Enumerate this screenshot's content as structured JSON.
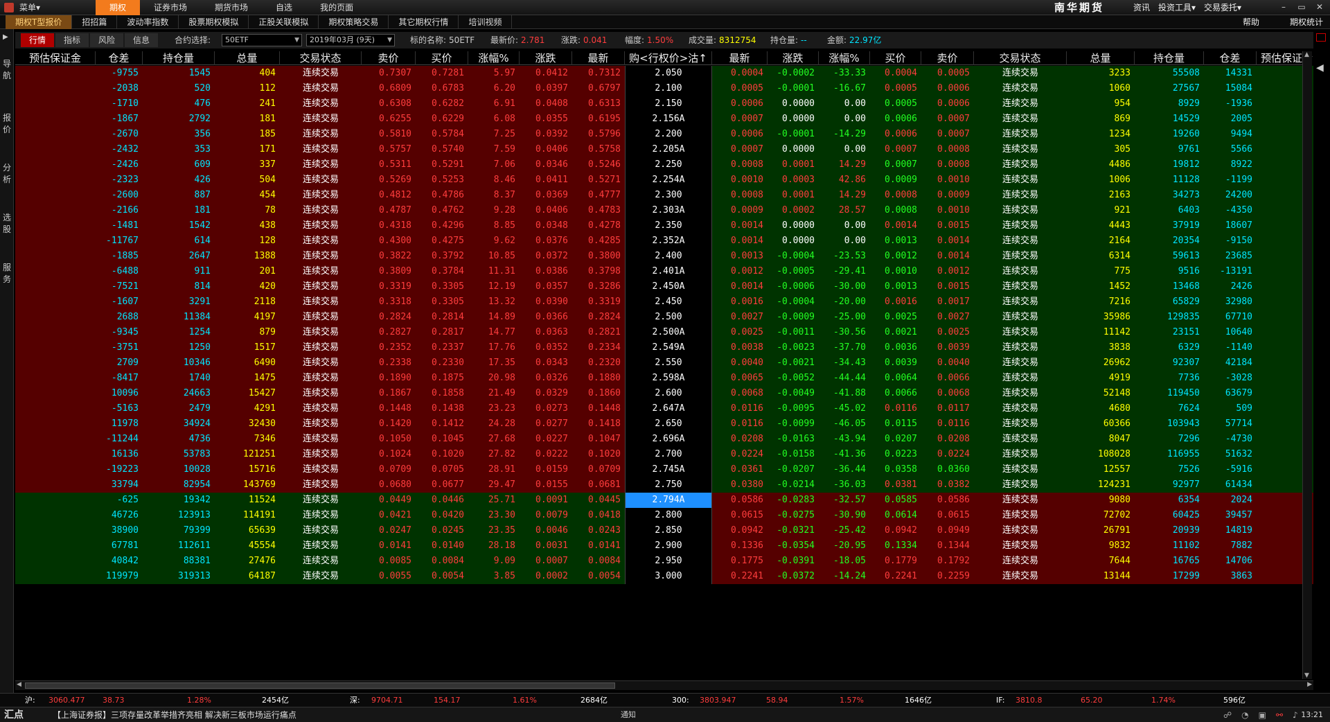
{
  "topbar": {
    "menu_label": "菜单▾",
    "tabs": [
      "期权",
      "证券市场",
      "期货市场",
      "自选",
      "我的页面"
    ],
    "brand": "南华期货",
    "right": [
      "资讯",
      "投资工具▾",
      "交易委托▾"
    ],
    "window_controls": [
      "–",
      "▭",
      "✕"
    ]
  },
  "subbar": {
    "tabs": [
      "期权T型报价",
      "招招篇",
      "波动率指数",
      "股票期权模拟",
      "正股关联模拟",
      "期权策略交易",
      "其它期权行情",
      "培训视频"
    ],
    "right": [
      "帮助",
      "期权统计"
    ]
  },
  "leftnav": [
    "导航",
    "报价",
    "分析",
    "选股",
    "服务"
  ],
  "toolbar": {
    "tabs": [
      "行情",
      "指标",
      "风险",
      "信息"
    ],
    "contract_label": "合约选择:",
    "contract_value": "50ETF",
    "month_value": "2019年03月 (9天)",
    "underlying_label": "标的名称:",
    "underlying_value": "50ETF",
    "last_label": "最新价:",
    "last_value": "2.781",
    "chg_label": "涨跌:",
    "chg_value": "0.041",
    "amp_label": "幅度:",
    "amp_value": "1.50%",
    "vol_label": "成交量:",
    "vol_value": "8312754",
    "oi_label": "持仓量:",
    "oi_value": "--",
    "amt_label": "金额:",
    "amt_value": "22.97亿"
  },
  "headers": [
    "预估保证金",
    "仓差",
    "持仓量",
    "总量",
    "交易状态",
    "卖价",
    "买价",
    "涨幅%",
    "涨跌",
    "最新",
    "购<行权价>沽↑",
    "最新",
    "涨跌",
    "涨幅%",
    "买价",
    "卖价",
    "交易状态",
    "总量",
    "持仓量",
    "仓差",
    "预估保证金"
  ],
  "status_text": "连续交易",
  "highlight_strike": "2.794A",
  "rows": [
    {
      "cd": "-9755",
      "coi": "1545",
      "cv": "404",
      "cs": "0.7307",
      "cb": "0.7281",
      "cp": "5.97",
      "cc": "0.0412",
      "cl": "0.7312",
      "k": "2.050",
      "pl": "0.0004",
      "pc": "-0.0002",
      "pp": "-33.33",
      "pb": "0.0004",
      "ps": "0.0005",
      "pv": "3233",
      "poi": "55508",
      "pd": "14331"
    },
    {
      "cd": "-2038",
      "coi": "520",
      "cv": "112",
      "cs": "0.6809",
      "cb": "0.6783",
      "cp": "6.20",
      "cc": "0.0397",
      "cl": "0.6797",
      "k": "2.100",
      "pl": "0.0005",
      "pc": "-0.0001",
      "pp": "-16.67",
      "pb": "0.0005",
      "ps": "0.0006",
      "pv": "1060",
      "poi": "27567",
      "pd": "15084"
    },
    {
      "cd": "-1710",
      "coi": "476",
      "cv": "241",
      "cs": "0.6308",
      "cb": "0.6282",
      "cp": "6.91",
      "cc": "0.0408",
      "cl": "0.6313",
      "k": "2.150",
      "pl": "0.0006",
      "pc": "0.0000",
      "pp": "0.00",
      "pb": "0.0005",
      "ps": "0.0006",
      "pv": "954",
      "poi": "8929",
      "pd": "-1936"
    },
    {
      "cd": "-1867",
      "coi": "2792",
      "cv": "181",
      "cs": "0.6255",
      "cb": "0.6229",
      "cp": "6.08",
      "cc": "0.0355",
      "cl": "0.6195",
      "k": "2.156A",
      "pl": "0.0007",
      "pc": "0.0000",
      "pp": "0.00",
      "pb": "0.0006",
      "ps": "0.0007",
      "pv": "869",
      "poi": "14529",
      "pd": "2005"
    },
    {
      "cd": "-2670",
      "coi": "356",
      "cv": "185",
      "cs": "0.5810",
      "cb": "0.5784",
      "cp": "7.25",
      "cc": "0.0392",
      "cl": "0.5796",
      "k": "2.200",
      "pl": "0.0006",
      "pc": "-0.0001",
      "pp": "-14.29",
      "pb": "0.0006",
      "ps": "0.0007",
      "pv": "1234",
      "poi": "19260",
      "pd": "9494"
    },
    {
      "cd": "-2432",
      "coi": "353",
      "cv": "171",
      "cs": "0.5757",
      "cb": "0.5740",
      "cp": "7.59",
      "cc": "0.0406",
      "cl": "0.5758",
      "k": "2.205A",
      "pl": "0.0007",
      "pc": "0.0000",
      "pp": "0.00",
      "pb": "0.0007",
      "ps": "0.0008",
      "pv": "305",
      "poi": "9761",
      "pd": "5566"
    },
    {
      "cd": "-2426",
      "coi": "609",
      "cv": "337",
      "cs": "0.5311",
      "cb": "0.5291",
      "cp": "7.06",
      "cc": "0.0346",
      "cl": "0.5246",
      "k": "2.250",
      "pl": "0.0008",
      "pc": "0.0001",
      "pp": "14.29",
      "pb": "0.0007",
      "ps": "0.0008",
      "pv": "4486",
      "poi": "19812",
      "pd": "8922"
    },
    {
      "cd": "-2323",
      "coi": "426",
      "cv": "504",
      "cs": "0.5269",
      "cb": "0.5253",
      "cp": "8.46",
      "cc": "0.0411",
      "cl": "0.5271",
      "k": "2.254A",
      "pl": "0.0010",
      "pc": "0.0003",
      "pp": "42.86",
      "pb": "0.0009",
      "ps": "0.0010",
      "pv": "1006",
      "poi": "11128",
      "pd": "-1199"
    },
    {
      "cd": "-2600",
      "coi": "887",
      "cv": "454",
      "cs": "0.4812",
      "cb": "0.4786",
      "cp": "8.37",
      "cc": "0.0369",
      "cl": "0.4777",
      "k": "2.300",
      "pl": "0.0008",
      "pc": "0.0001",
      "pp": "14.29",
      "pb": "0.0008",
      "ps": "0.0009",
      "pv": "2163",
      "poi": "34273",
      "pd": "24200"
    },
    {
      "cd": "-2166",
      "coi": "181",
      "cv": "78",
      "cs": "0.4787",
      "cb": "0.4762",
      "cp": "9.28",
      "cc": "0.0406",
      "cl": "0.4783",
      "k": "2.303A",
      "pl": "0.0009",
      "pc": "0.0002",
      "pp": "28.57",
      "pb": "0.0008",
      "ps": "0.0010",
      "pv": "921",
      "poi": "6403",
      "pd": "-4350"
    },
    {
      "cd": "-1481",
      "coi": "1542",
      "cv": "438",
      "cs": "0.4318",
      "cb": "0.4296",
      "cp": "8.85",
      "cc": "0.0348",
      "cl": "0.4278",
      "k": "2.350",
      "pl": "0.0014",
      "pc": "0.0000",
      "pp": "0.00",
      "pb": "0.0014",
      "ps": "0.0015",
      "pv": "4443",
      "poi": "37919",
      "pd": "18607"
    },
    {
      "cd": "-11767",
      "coi": "614",
      "cv": "128",
      "cs": "0.4300",
      "cb": "0.4275",
      "cp": "9.62",
      "cc": "0.0376",
      "cl": "0.4285",
      "k": "2.352A",
      "pl": "0.0014",
      "pc": "0.0000",
      "pp": "0.00",
      "pb": "0.0013",
      "ps": "0.0014",
      "pv": "2164",
      "poi": "20354",
      "pd": "-9150"
    },
    {
      "cd": "-1885",
      "coi": "2647",
      "cv": "1388",
      "cs": "0.3822",
      "cb": "0.3792",
      "cp": "10.85",
      "cc": "0.0372",
      "cl": "0.3800",
      "k": "2.400",
      "pl": "0.0013",
      "pc": "-0.0004",
      "pp": "-23.53",
      "pb": "0.0012",
      "ps": "0.0014",
      "pv": "6314",
      "poi": "59613",
      "pd": "23685"
    },
    {
      "cd": "-6488",
      "coi": "911",
      "cv": "201",
      "cs": "0.3809",
      "cb": "0.3784",
      "cp": "11.31",
      "cc": "0.0386",
      "cl": "0.3798",
      "k": "2.401A",
      "pl": "0.0012",
      "pc": "-0.0005",
      "pp": "-29.41",
      "pb": "0.0010",
      "ps": "0.0012",
      "pv": "775",
      "poi": "9516",
      "pd": "-13191"
    },
    {
      "cd": "-7521",
      "coi": "814",
      "cv": "420",
      "cs": "0.3319",
      "cb": "0.3305",
      "cp": "12.19",
      "cc": "0.0357",
      "cl": "0.3286",
      "k": "2.450A",
      "pl": "0.0014",
      "pc": "-0.0006",
      "pp": "-30.00",
      "pb": "0.0013",
      "ps": "0.0015",
      "pv": "1452",
      "poi": "13468",
      "pd": "2426"
    },
    {
      "cd": "-1607",
      "coi": "3291",
      "cv": "2118",
      "cs": "0.3318",
      "cb": "0.3305",
      "cp": "13.32",
      "cc": "0.0390",
      "cl": "0.3319",
      "k": "2.450",
      "pl": "0.0016",
      "pc": "-0.0004",
      "pp": "-20.00",
      "pb": "0.0016",
      "ps": "0.0017",
      "pv": "7216",
      "poi": "65829",
      "pd": "32980"
    },
    {
      "cd": "2688",
      "coi": "11384",
      "cv": "4197",
      "cs": "0.2824",
      "cb": "0.2814",
      "cp": "14.89",
      "cc": "0.0366",
      "cl": "0.2824",
      "k": "2.500",
      "pl": "0.0027",
      "pc": "-0.0009",
      "pp": "-25.00",
      "pb": "0.0025",
      "ps": "0.0027",
      "pv": "35986",
      "poi": "129835",
      "pd": "67710"
    },
    {
      "cd": "-9345",
      "coi": "1254",
      "cv": "879",
      "cs": "0.2827",
      "cb": "0.2817",
      "cp": "14.77",
      "cc": "0.0363",
      "cl": "0.2821",
      "k": "2.500A",
      "pl": "0.0025",
      "pc": "-0.0011",
      "pp": "-30.56",
      "pb": "0.0021",
      "ps": "0.0025",
      "pv": "11142",
      "poi": "23151",
      "pd": "10640"
    },
    {
      "cd": "-3751",
      "coi": "1250",
      "cv": "1517",
      "cs": "0.2352",
      "cb": "0.2337",
      "cp": "17.76",
      "cc": "0.0352",
      "cl": "0.2334",
      "k": "2.549A",
      "pl": "0.0038",
      "pc": "-0.0023",
      "pp": "-37.70",
      "pb": "0.0036",
      "ps": "0.0039",
      "pv": "3838",
      "poi": "6329",
      "pd": "-1140"
    },
    {
      "cd": "2709",
      "coi": "10346",
      "cv": "6490",
      "cs": "0.2338",
      "cb": "0.2330",
      "cp": "17.35",
      "cc": "0.0343",
      "cl": "0.2320",
      "k": "2.550",
      "pl": "0.0040",
      "pc": "-0.0021",
      "pp": "-34.43",
      "pb": "0.0039",
      "ps": "0.0040",
      "pv": "26962",
      "poi": "92307",
      "pd": "42184"
    },
    {
      "cd": "-8417",
      "coi": "1740",
      "cv": "1475",
      "cs": "0.1890",
      "cb": "0.1875",
      "cp": "20.98",
      "cc": "0.0326",
      "cl": "0.1880",
      "k": "2.598A",
      "pl": "0.0065",
      "pc": "-0.0052",
      "pp": "-44.44",
      "pb": "0.0064",
      "ps": "0.0066",
      "pv": "4919",
      "poi": "7736",
      "pd": "-3028"
    },
    {
      "cd": "10096",
      "coi": "24663",
      "cv": "15427",
      "cs": "0.1867",
      "cb": "0.1858",
      "cp": "21.49",
      "cc": "0.0329",
      "cl": "0.1860",
      "k": "2.600",
      "pl": "0.0068",
      "pc": "-0.0049",
      "pp": "-41.88",
      "pb": "0.0066",
      "ps": "0.0068",
      "pv": "52148",
      "poi": "119450",
      "pd": "63679"
    },
    {
      "cd": "-5163",
      "coi": "2479",
      "cv": "4291",
      "cs": "0.1448",
      "cb": "0.1438",
      "cp": "23.23",
      "cc": "0.0273",
      "cl": "0.1448",
      "k": "2.647A",
      "pl": "0.0116",
      "pc": "-0.0095",
      "pp": "-45.02",
      "pb": "0.0116",
      "ps": "0.0117",
      "pv": "4680",
      "poi": "7624",
      "pd": "509"
    },
    {
      "cd": "11978",
      "coi": "34924",
      "cv": "32430",
      "cs": "0.1420",
      "cb": "0.1412",
      "cp": "24.28",
      "cc": "0.0277",
      "cl": "0.1418",
      "k": "2.650",
      "pl": "0.0116",
      "pc": "-0.0099",
      "pp": "-46.05",
      "pb": "0.0115",
      "ps": "0.0116",
      "pv": "60366",
      "poi": "103943",
      "pd": "57714"
    },
    {
      "cd": "-11244",
      "coi": "4736",
      "cv": "7346",
      "cs": "0.1050",
      "cb": "0.1045",
      "cp": "27.68",
      "cc": "0.0227",
      "cl": "0.1047",
      "k": "2.696A",
      "pl": "0.0208",
      "pc": "-0.0163",
      "pp": "-43.94",
      "pb": "0.0207",
      "ps": "0.0208",
      "pv": "8047",
      "poi": "7296",
      "pd": "-4730"
    },
    {
      "cd": "16136",
      "coi": "53783",
      "cv": "121251",
      "cs": "0.1024",
      "cb": "0.1020",
      "cp": "27.82",
      "cc": "0.0222",
      "cl": "0.1020",
      "k": "2.700",
      "pl": "0.0224",
      "pc": "-0.0158",
      "pp": "-41.36",
      "pb": "0.0223",
      "ps": "0.0224",
      "pv": "108028",
      "poi": "116955",
      "pd": "51632"
    },
    {
      "cd": "-19223",
      "coi": "10028",
      "cv": "15716",
      "cs": "0.0709",
      "cb": "0.0705",
      "cp": "28.91",
      "cc": "0.0159",
      "cl": "0.0709",
      "k": "2.745A",
      "pl": "0.0361",
      "pc": "-0.0207",
      "pp": "-36.44",
      "pb": "0.0358",
      "ps": "0.0360",
      "pv": "12557",
      "poi": "7526",
      "pd": "-5916"
    },
    {
      "cd": "33794",
      "coi": "82954",
      "cv": "143769",
      "cs": "0.0680",
      "cb": "0.0677",
      "cp": "29.47",
      "cc": "0.0155",
      "cl": "0.0681",
      "k": "2.750",
      "pl": "0.0380",
      "pc": "-0.0214",
      "pp": "-36.03",
      "pb": "0.0381",
      "ps": "0.0382",
      "pv": "124231",
      "poi": "92977",
      "pd": "61434"
    },
    {
      "cd": "-625",
      "coi": "19342",
      "cv": "11524",
      "cs": "0.0449",
      "cb": "0.0446",
      "cp": "25.71",
      "cc": "0.0091",
      "cl": "0.0445",
      "k": "2.794A",
      "pl": "0.0586",
      "pc": "-0.0283",
      "pp": "-32.57",
      "pb": "0.0585",
      "ps": "0.0586",
      "pv": "9080",
      "poi": "6354",
      "pd": "2024"
    },
    {
      "cd": "46726",
      "coi": "123913",
      "cv": "114191",
      "cs": "0.0421",
      "cb": "0.0420",
      "cp": "23.30",
      "cc": "0.0079",
      "cl": "0.0418",
      "k": "2.800",
      "pl": "0.0615",
      "pc": "-0.0275",
      "pp": "-30.90",
      "pb": "0.0614",
      "ps": "0.0615",
      "pv": "72702",
      "poi": "60425",
      "pd": "39457"
    },
    {
      "cd": "38900",
      "coi": "79399",
      "cv": "65639",
      "cs": "0.0247",
      "cb": "0.0245",
      "cp": "23.35",
      "cc": "0.0046",
      "cl": "0.0243",
      "k": "2.850",
      "pl": "0.0942",
      "pc": "-0.0321",
      "pp": "-25.42",
      "pb": "0.0942",
      "ps": "0.0949",
      "pv": "26791",
      "poi": "20939",
      "pd": "14819"
    },
    {
      "cd": "67781",
      "coi": "112611",
      "cv": "45554",
      "cs": "0.0141",
      "cb": "0.0140",
      "cp": "28.18",
      "cc": "0.0031",
      "cl": "0.0141",
      "k": "2.900",
      "pl": "0.1336",
      "pc": "-0.0354",
      "pp": "-20.95",
      "pb": "0.1334",
      "ps": "0.1344",
      "pv": "9832",
      "poi": "11102",
      "pd": "7882"
    },
    {
      "cd": "40842",
      "coi": "88381",
      "cv": "27476",
      "cs": "0.0085",
      "cb": "0.0084",
      "cp": "9.09",
      "cc": "0.0007",
      "cl": "0.0084",
      "k": "2.950",
      "pl": "0.1775",
      "pc": "-0.0391",
      "pp": "-18.05",
      "pb": "0.1779",
      "ps": "0.1792",
      "pv": "7644",
      "poi": "16765",
      "pd": "14706"
    },
    {
      "cd": "119979",
      "coi": "319313",
      "cv": "64187",
      "cs": "0.0055",
      "cb": "0.0054",
      "cp": "3.85",
      "cc": "0.0002",
      "cl": "0.0054",
      "k": "3.000",
      "pl": "0.2241",
      "pc": "-0.0372",
      "pp": "-14.24",
      "pb": "0.2241",
      "ps": "0.2259",
      "pv": "13144",
      "poi": "17299",
      "pd": "3863"
    }
  ],
  "indexbar": [
    {
      "label": "沪:",
      "val": "3060.477",
      "chg": "38.73",
      "pct": "1.28%",
      "amt": "2454亿"
    },
    {
      "label": "深:",
      "val": "9704.71",
      "chg": "154.17",
      "pct": "1.61%",
      "amt": "2684亿"
    },
    {
      "label": "300:",
      "val": "3803.947",
      "chg": "58.94",
      "pct": "1.57%",
      "amt": "1646亿"
    },
    {
      "label": "IF:",
      "val": "3810.8",
      "chg": "65.20",
      "pct": "1.74%",
      "amt": "596亿"
    }
  ],
  "news": {
    "label": "汇点",
    "text": "【上海证券报】三项存量改革举措齐亮相 解决新三板市场运行痛点",
    "center": "通知",
    "time": "13:21"
  },
  "colors": {
    "accent": "#f37b1d",
    "call_bg": "#550000",
    "put_bg": "#003300",
    "highlight": "#1e90ff"
  }
}
